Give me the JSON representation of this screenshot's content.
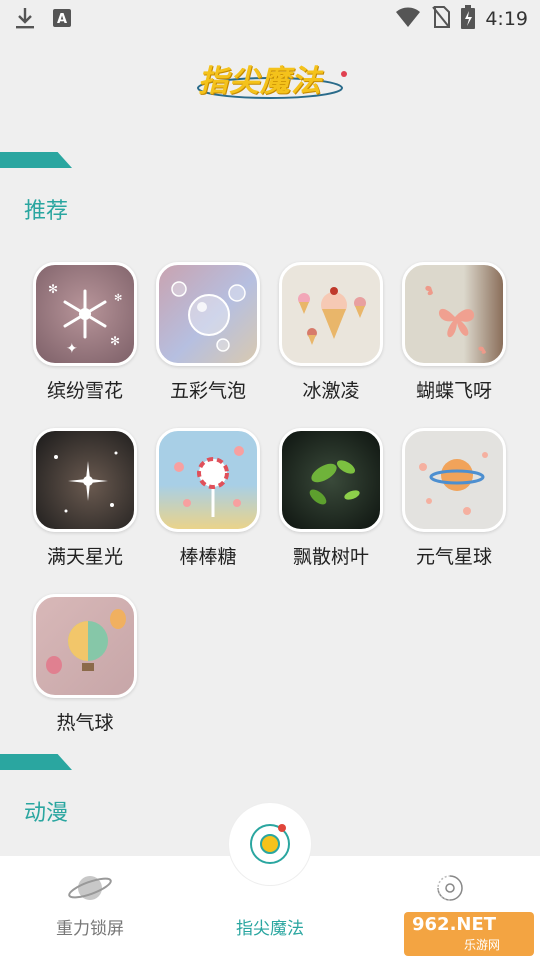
{
  "status_bar": {
    "time": "4:19",
    "icons_left": [
      "download-icon",
      "text-a-icon"
    ],
    "icons_right": [
      "wifi-icon",
      "no-sim-icon",
      "battery-icon"
    ]
  },
  "logo": {
    "text": "指尖魔法"
  },
  "sections": [
    {
      "title": "推荐"
    },
    {
      "title": "动漫"
    }
  ],
  "items": [
    {
      "label": "缤纷雪花",
      "icon": "snowflake-thumb"
    },
    {
      "label": "五彩气泡",
      "icon": "bubble-thumb"
    },
    {
      "label": "冰激凌",
      "icon": "ice-cream-thumb"
    },
    {
      "label": "蝴蝶飞呀",
      "icon": "butterfly-thumb"
    },
    {
      "label": "满天星光",
      "icon": "starlight-thumb"
    },
    {
      "label": "棒棒糖",
      "icon": "lollipop-thumb"
    },
    {
      "label": "飘散树叶",
      "icon": "leaves-thumb"
    },
    {
      "label": "元气星球",
      "icon": "planet-thumb"
    },
    {
      "label": "热气球",
      "icon": "hot-air-balloon-thumb"
    }
  ],
  "bottom_nav": [
    {
      "label": "重力锁屏",
      "icon": "planet-icon",
      "active": false
    },
    {
      "label": "指尖魔法",
      "icon": "orbit-icon",
      "active": true
    },
    {
      "label": "",
      "icon": "galaxy-icon",
      "active": false
    }
  ],
  "watermark": {
    "main": "962.NET",
    "sub": "乐游网"
  },
  "colors": {
    "accent": "#2aa6a0",
    "background": "#efefef",
    "logo": "#f4c21b"
  }
}
